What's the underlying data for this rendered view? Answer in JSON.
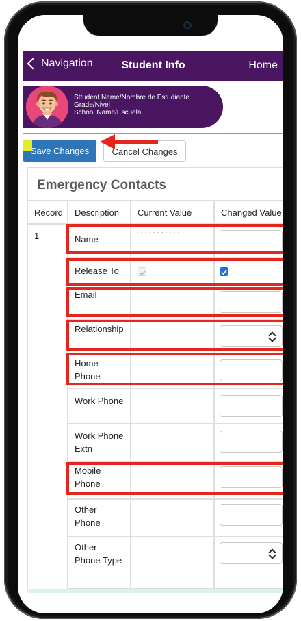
{
  "nav": {
    "back_label": "Navigation",
    "title": "Student Info",
    "home_label": "Home"
  },
  "student": {
    "line1": "Sttudent Name/Nombre de Estudiante",
    "line2": "Grade/Nivel",
    "line3": "School Name/Escuela"
  },
  "buttons": {
    "save": "Save Changes",
    "cancel": "Cancel Changes"
  },
  "section_title": "Emergency Contacts",
  "table": {
    "headers": [
      "Record",
      "Description",
      "Current Value",
      "Changed Value"
    ],
    "record": "1",
    "rows": [
      {
        "desc": "Name",
        "control": "text"
      },
      {
        "desc": "Release To",
        "control": "checkbox",
        "current_checked": true,
        "changed_checked": true
      },
      {
        "desc": "Email",
        "control": "text"
      },
      {
        "desc": "Relationship",
        "control": "select"
      },
      {
        "desc": "Home Phone",
        "control": "text"
      },
      {
        "desc": "Work Phone",
        "control": "text"
      },
      {
        "desc": "Work Phone Extn",
        "control": "text"
      },
      {
        "desc": "Mobile Phone",
        "control": "text"
      },
      {
        "desc": "Other Phone",
        "control": "text"
      },
      {
        "desc": "Other Phone Type",
        "control": "select"
      }
    ]
  },
  "colors": {
    "nav_bg": "#4a1662",
    "save_button": "#2f76b9",
    "highlight_red": "#e5261c",
    "checkbox_blue": "#1f6fd6"
  }
}
